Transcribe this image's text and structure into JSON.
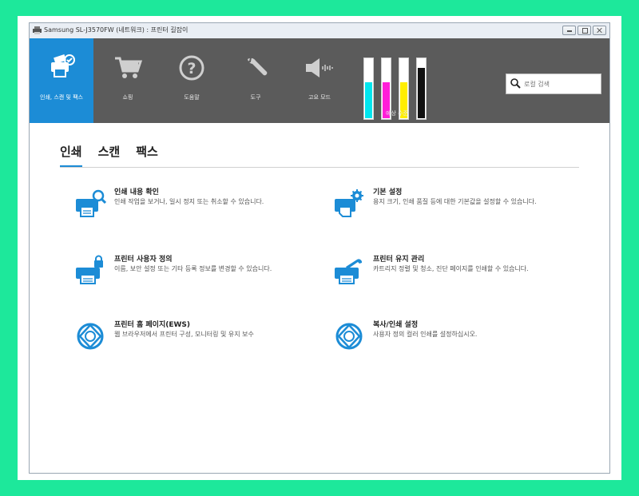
{
  "window": {
    "title": "Samsung SL-J3570FW (네트워크) : 프린터 길잡이"
  },
  "toolbar": {
    "items": [
      {
        "label": "인쇄, 스캔 및 팩스",
        "icon": "print-scan-fax-icon",
        "active": true
      },
      {
        "label": "쇼핑",
        "icon": "cart-icon",
        "active": false
      },
      {
        "label": "도움말",
        "icon": "help-icon",
        "active": false
      },
      {
        "label": "도구",
        "icon": "wrench-icon",
        "active": false
      },
      {
        "label": "고요 모드",
        "icon": "quiet-mode-icon",
        "active": false
      }
    ],
    "ink_label": "예상 수준",
    "ink_levels": [
      {
        "color": "#00e5ee",
        "level": 0.62
      },
      {
        "color": "#ff1ed8",
        "level": 0.62
      },
      {
        "color": "#ffee00",
        "level": 0.62
      },
      {
        "color": "#111111",
        "level": 0.86
      }
    ],
    "search_placeholder": "로컬 검색"
  },
  "tabs": [
    {
      "label": "인쇄",
      "active": true
    },
    {
      "label": "스캔",
      "active": false
    },
    {
      "label": "팩스",
      "active": false
    }
  ],
  "cards": {
    "print_preview": {
      "title": "인쇄 내용 확인",
      "desc": "인쇄 작업을 보거나, 일시 정지 또는 취소할 수 있습니다."
    },
    "default_settings": {
      "title": "기본 설정",
      "desc": "용지 크기, 인쇄 품질 등에 대한 기본값을 설정할 수 있습니다."
    },
    "customize_printer": {
      "title": "프린터 사용자 정의",
      "desc": "이름, 보안 설정 또는 기타 등록 정보를 변경할 수 있습니다."
    },
    "maintain_printer": {
      "title": "프린터 유지 관리",
      "desc": "카트리지 정렬 및 청소, 진단 페이지를 인쇄할 수 있습니다."
    },
    "printer_home": {
      "title": "프린터 홈 페이지(EWS)",
      "desc": "웹 브라우저에서 프린터 구성, 모니터링 및 유지 보수"
    },
    "copy_print_settings": {
      "title": "복사/인쇄 설정",
      "desc": "사용자 정의 컬러 인쇄를 설정하십시오."
    }
  },
  "colors": {
    "accent": "#1c8cd6",
    "toolbar": "#5b5b5b",
    "background": "#1de89b"
  }
}
